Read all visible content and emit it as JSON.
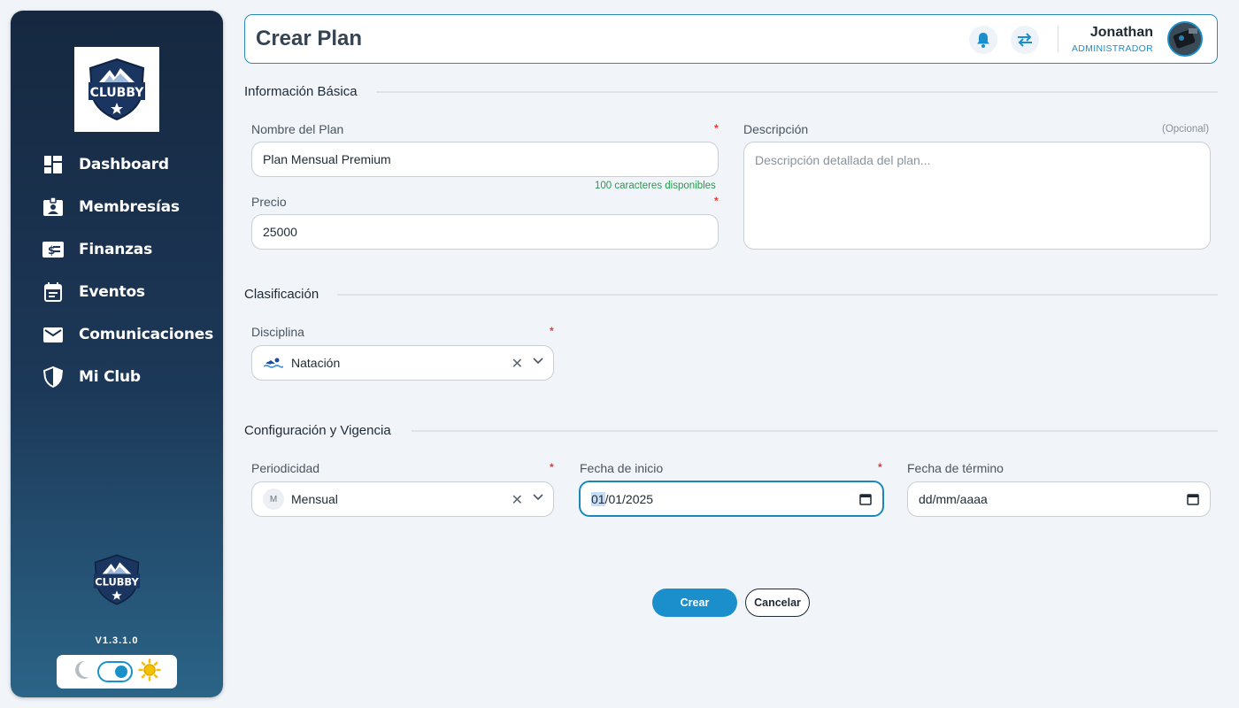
{
  "sidebar": {
    "logo_text": "CLUBBY",
    "items": [
      {
        "label": "Dashboard",
        "icon": "dashboard-icon"
      },
      {
        "label": "Membresías",
        "icon": "id-badge-icon"
      },
      {
        "label": "Finanzas",
        "icon": "money-icon"
      },
      {
        "label": "Eventos",
        "icon": "calendar-icon"
      },
      {
        "label": "Comunicaciones",
        "icon": "mail-icon"
      },
      {
        "label": "Mi Club",
        "icon": "shield-icon"
      }
    ],
    "version": "V1.3.1.0",
    "theme": {
      "mode": "light"
    }
  },
  "header": {
    "title": "Crear Plan",
    "user_name": "Jonathan",
    "user_role": "ADMINISTRADOR"
  },
  "sections": {
    "basic": "Información Básica",
    "classification": "Clasificación",
    "config": "Configuración y Vigencia"
  },
  "form": {
    "name": {
      "label": "Nombre del Plan",
      "required": "*",
      "value": "Plan Mensual Premium",
      "hint": "100 caracteres disponibles"
    },
    "price": {
      "label": "Precio",
      "required": "*",
      "value": "25000"
    },
    "description": {
      "label": "Descripción",
      "optional": "(Opcional)",
      "placeholder": "Descripción detallada del plan..."
    },
    "discipline": {
      "label": "Disciplina",
      "required": "*",
      "value": "Natación"
    },
    "periodicity": {
      "label": "Periodicidad",
      "required": "*",
      "value": "Mensual",
      "badge": "M"
    },
    "start_date": {
      "label": "Fecha de inicio",
      "required": "*",
      "value_day": "01",
      "value_rest": "/01/2025"
    },
    "end_date": {
      "label": "Fecha de término",
      "value": "dd/mm/aaaa"
    }
  },
  "actions": {
    "create": "Crear",
    "cancel": "Cancelar"
  },
  "colors": {
    "accent": "#1a8fcb",
    "sidebar_top": "#162840",
    "sidebar_bottom": "#2b6487",
    "hint_green": "#1f9e4a",
    "required_red": "#e53935"
  }
}
